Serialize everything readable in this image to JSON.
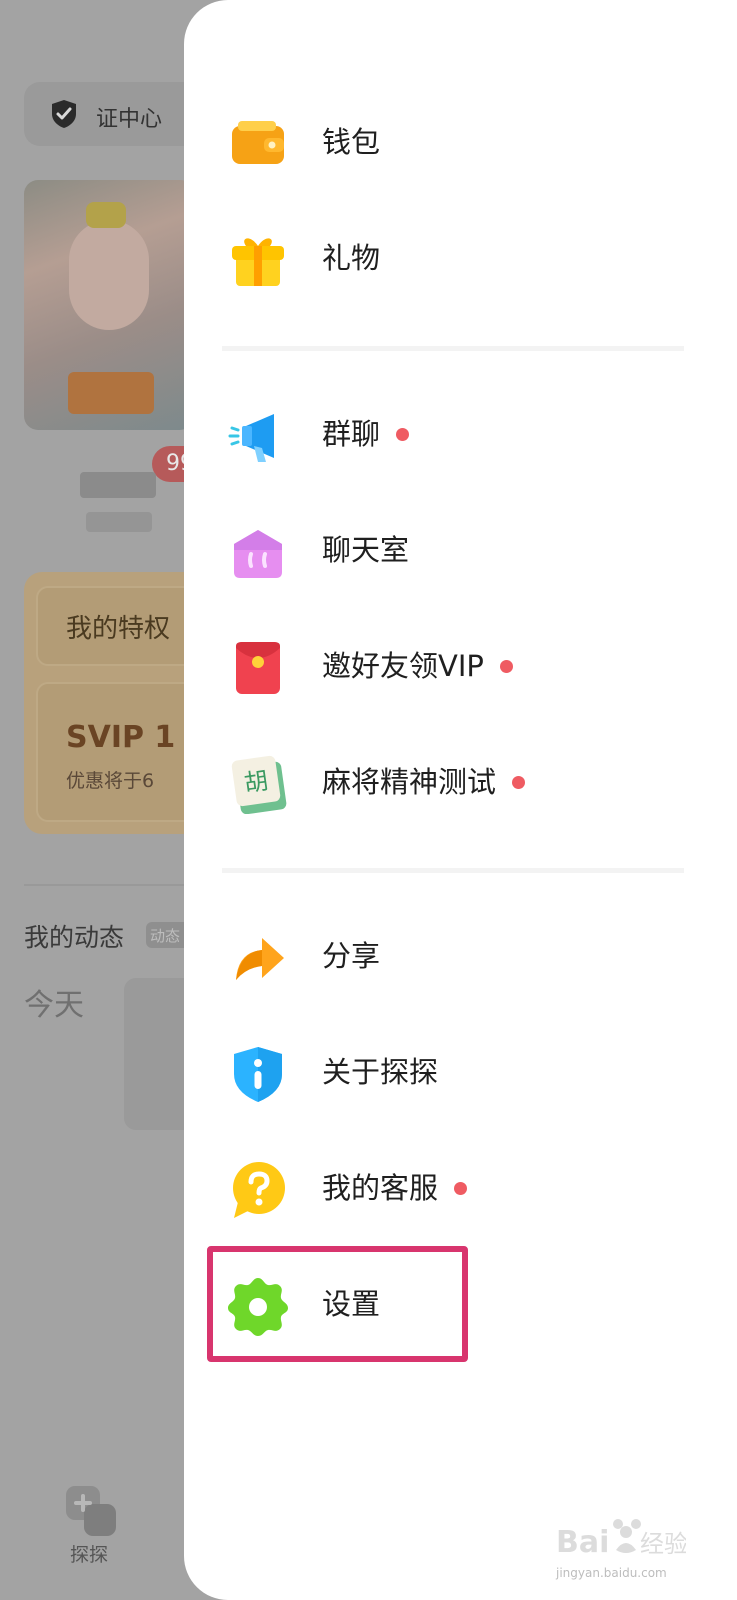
{
  "background": {
    "verify_center": "证中心",
    "badge_count": "99",
    "privilege_title": "我的特权",
    "svip_title": "SVIP 1",
    "svip_subtitle": "优惠将于6",
    "moments_title": "我的动态",
    "moments_tag": "动态",
    "today_label": "今天",
    "bottom_nav_label": "探探"
  },
  "drawer": {
    "sections": [
      {
        "items": [
          {
            "label": "钱包",
            "icon": "wallet-icon",
            "dot": false
          },
          {
            "label": "礼物",
            "icon": "gift-icon",
            "dot": false
          }
        ]
      },
      {
        "items": [
          {
            "label": "群聊",
            "icon": "megaphone-icon",
            "dot": true
          },
          {
            "label": "聊天室",
            "icon": "chatroom-icon",
            "dot": false
          },
          {
            "label": "邀好友领VIP",
            "icon": "red-envelope-icon",
            "dot": true
          },
          {
            "label": "麻将精神测试",
            "icon": "mahjong-tile-icon",
            "dot": true
          }
        ]
      },
      {
        "items": [
          {
            "label": "分享",
            "icon": "share-arrow-icon",
            "dot": false
          },
          {
            "label": "关于探探",
            "icon": "info-shield-icon",
            "dot": false
          },
          {
            "label": "我的客服",
            "icon": "help-bubble-icon",
            "dot": true
          },
          {
            "label": "设置",
            "icon": "settings-gear-icon",
            "dot": false,
            "highlighted": true
          }
        ]
      }
    ]
  },
  "colors": {
    "notification_dot": "#ef5b62",
    "highlight_border": "#d8356e",
    "drawer_background": "#ffffff",
    "overlay": "#a3a3a3"
  },
  "watermark": {
    "text": "jingyan.baidu.com"
  }
}
